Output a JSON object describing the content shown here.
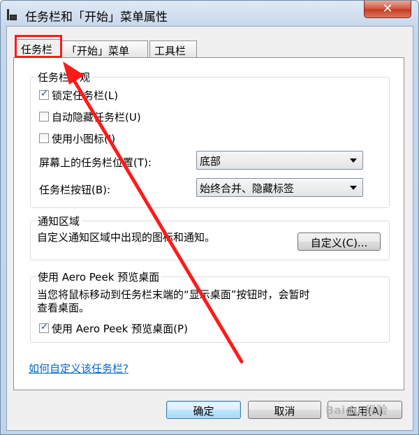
{
  "window": {
    "title": "任务栏和「开始」菜单属性",
    "close_label": "✕"
  },
  "tabs": [
    {
      "label": "任务栏",
      "selected": true
    },
    {
      "label": "「开始」菜单",
      "selected": false
    },
    {
      "label": "工具栏",
      "selected": false
    }
  ],
  "appearance": {
    "legend": "任务栏外观",
    "lock_taskbar": {
      "label": "锁定任务栏(L)",
      "checked": true
    },
    "auto_hide": {
      "label": "自动隐藏任务栏(U)",
      "checked": false
    },
    "small_icons": {
      "label": "使用小图标(I)",
      "checked": false
    },
    "location_label": "屏幕上的任务栏位置(T):",
    "location_value": "底部",
    "buttons_label": "任务栏按钮(B):",
    "buttons_value": "始终合并、隐藏标签"
  },
  "notification": {
    "legend": "通知区域",
    "description": "自定义通知区域中出现的图标和通知。",
    "customize_button": "自定义(C)..."
  },
  "aero_peek": {
    "legend": "使用 Aero Peek 预览桌面",
    "description_line1": "当您将鼠标移动到任务栏末端的“显示桌面”按钮时，会暂时",
    "description_line2": "查看桌面。",
    "checkbox": {
      "label": "使用 Aero Peek 预览桌面(P)",
      "checked": true
    }
  },
  "help_link": "如何自定义该任务栏?",
  "footer": {
    "ok": "确定",
    "cancel": "取消",
    "apply": "应用(A)"
  },
  "watermark": "Baidu 经验",
  "colors": {
    "highlight": "#ff1a1a",
    "link": "#0066cc"
  }
}
